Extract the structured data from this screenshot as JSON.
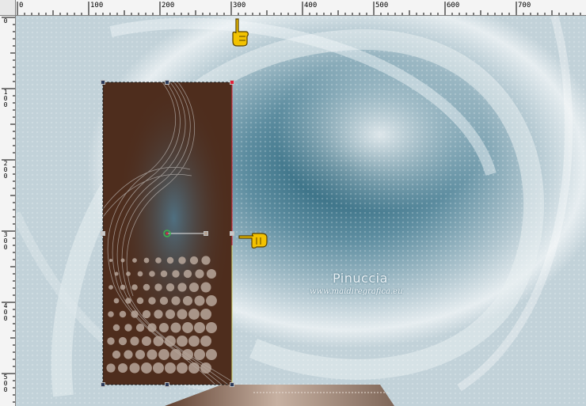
{
  "rulers": {
    "top_labels": [
      "0",
      "100",
      "200",
      "300",
      "400",
      "500",
      "600",
      "700"
    ],
    "left_labels": [
      "0",
      "100",
      "200",
      "300",
      "400",
      "500"
    ]
  },
  "watermark": {
    "name": "Pinuccia",
    "url": "www.maidiregrafica.eu"
  },
  "colors": {
    "layer_fill": "#4e2d1d",
    "canvas_center": "#1e5b72",
    "canvas_light": "#e6edf0",
    "selected_handle": "#e0203a"
  },
  "icons": [
    "hand-pointer-down-icon",
    "hand-pointer-left-icon",
    "rotation-pivot-icon"
  ]
}
